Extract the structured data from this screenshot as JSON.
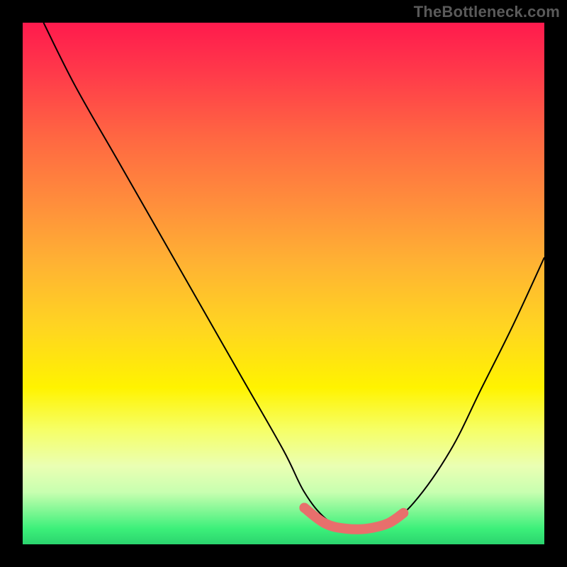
{
  "watermark": "TheBottleneck.com",
  "chart_data": {
    "type": "line",
    "title": "",
    "xlabel": "",
    "ylabel": "",
    "xlim": [
      0,
      100
    ],
    "ylim": [
      0,
      100
    ],
    "grid": false,
    "legend": false,
    "annotations": [],
    "series": [
      {
        "name": "primary-curve",
        "color": "#000000",
        "x": [
          4,
          10,
          18,
          26,
          34,
          42,
          50,
          54,
          58,
          62,
          66,
          70,
          75,
          82,
          88,
          94,
          100
        ],
        "y": [
          100,
          88,
          74,
          60,
          46,
          32,
          18,
          10,
          5,
          3,
          3,
          4,
          8,
          18,
          30,
          42,
          55
        ]
      },
      {
        "name": "highlight-segment",
        "color": "#e86f6c",
        "x": [
          54,
          58,
          62,
          66,
          70,
          73
        ],
        "y": [
          7,
          4,
          3,
          3,
          4,
          6
        ]
      }
    ],
    "background_gradient": {
      "stops": [
        {
          "pos": 0.0,
          "color": "#ff1a4d"
        },
        {
          "pos": 0.7,
          "color": "#fff300"
        },
        {
          "pos": 0.97,
          "color": "#3cf07a"
        }
      ]
    }
  }
}
